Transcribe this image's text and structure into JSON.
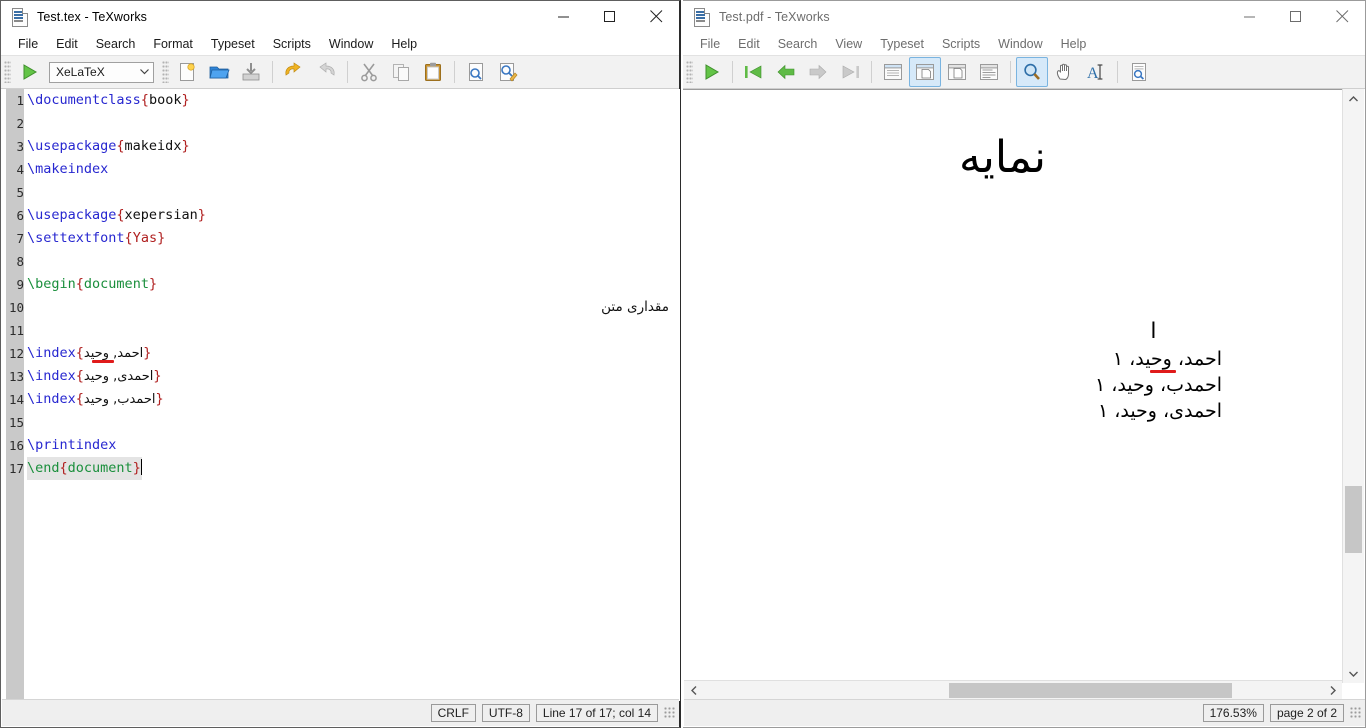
{
  "editor_window": {
    "title": "Test.tex - TeXworks",
    "title_icon": "tex-document-icon",
    "window_controls": [
      "minimize",
      "maximize",
      "close"
    ],
    "menu": [
      "File",
      "Edit",
      "Search",
      "Format",
      "Typeset",
      "Scripts",
      "Window",
      "Help"
    ],
    "toolbar": {
      "typeset_button": "typeset-run-icon",
      "engine_value": "XeLaTeX",
      "engine_options": [
        "XeLaTeX"
      ],
      "buttons": [
        "new-file-icon",
        "open-file-icon",
        "save-file-icon",
        "undo-icon",
        "redo-icon",
        "cut-icon",
        "copy-icon",
        "paste-icon",
        "find-icon",
        "replace-icon"
      ]
    },
    "code_lines": [
      {
        "n": "1",
        "tokens": [
          {
            "t": "\\documentclass",
            "c": "cmd"
          },
          {
            "t": "{",
            "c": "brace"
          },
          {
            "t": "book",
            "c": "txt"
          },
          {
            "t": "}",
            "c": "brace"
          }
        ]
      },
      {
        "n": "2",
        "tokens": []
      },
      {
        "n": "3",
        "tokens": [
          {
            "t": "\\usepackage",
            "c": "cmd"
          },
          {
            "t": "{",
            "c": "brace"
          },
          {
            "t": "makeidx",
            "c": "txt"
          },
          {
            "t": "}",
            "c": "brace"
          }
        ]
      },
      {
        "n": "4",
        "tokens": [
          {
            "t": "\\makeindex",
            "c": "cmd"
          }
        ]
      },
      {
        "n": "5",
        "tokens": []
      },
      {
        "n": "6",
        "tokens": [
          {
            "t": "\\usepackage",
            "c": "cmd"
          },
          {
            "t": "{",
            "c": "brace"
          },
          {
            "t": "xepersian",
            "c": "txt"
          },
          {
            "t": "}",
            "c": "brace"
          }
        ]
      },
      {
        "n": "7",
        "tokens": [
          {
            "t": "\\settextfont",
            "c": "cmd"
          },
          {
            "t": "{",
            "c": "brace"
          },
          {
            "t": "Yas",
            "c": "arg"
          },
          {
            "t": "}",
            "c": "brace"
          }
        ]
      },
      {
        "n": "8",
        "tokens": []
      },
      {
        "n": "9",
        "tokens": [
          {
            "t": "\\begin",
            "c": "env"
          },
          {
            "t": "{",
            "c": "brace"
          },
          {
            "t": "document",
            "c": "env"
          },
          {
            "t": "}",
            "c": "brace"
          }
        ]
      },
      {
        "n": "10",
        "tokens": [],
        "right_text": "مقداری متن"
      },
      {
        "n": "11",
        "tokens": []
      },
      {
        "n": "12",
        "tokens": [
          {
            "t": "\\index",
            "c": "cmd"
          },
          {
            "t": "{",
            "c": "brace"
          },
          {
            "t": "احمد, وحید",
            "c": "fa"
          },
          {
            "t": "}",
            "c": "brace"
          }
        ],
        "red_underline": true
      },
      {
        "n": "13",
        "tokens": [
          {
            "t": "\\index",
            "c": "cmd"
          },
          {
            "t": "{",
            "c": "brace"
          },
          {
            "t": "احمدی, وحید",
            "c": "fa"
          },
          {
            "t": "}",
            "c": "brace"
          }
        ]
      },
      {
        "n": "14",
        "tokens": [
          {
            "t": "\\index",
            "c": "cmd"
          },
          {
            "t": "{",
            "c": "brace"
          },
          {
            "t": "احمدب, وحید",
            "c": "fa"
          },
          {
            "t": "}",
            "c": "brace"
          }
        ]
      },
      {
        "n": "15",
        "tokens": []
      },
      {
        "n": "16",
        "tokens": [
          {
            "t": "\\printindex",
            "c": "cmd"
          }
        ]
      },
      {
        "n": "17",
        "tokens": [
          {
            "t": "\\end",
            "c": "env"
          },
          {
            "t": "{",
            "c": "brace"
          },
          {
            "t": "document",
            "c": "env"
          },
          {
            "t": "}",
            "c": "brace"
          }
        ],
        "current": true,
        "caret": true
      }
    ],
    "status": {
      "line_ending": "CRLF",
      "encoding": "UTF-8",
      "position": "Line 17 of 17; col 14"
    }
  },
  "pdf_window": {
    "title": "Test.pdf - TeXworks",
    "title_icon": "pdf-document-icon",
    "window_controls": [
      "minimize",
      "maximize",
      "close"
    ],
    "menu": [
      "File",
      "Edit",
      "Search",
      "View",
      "Typeset",
      "Scripts",
      "Window",
      "Help"
    ],
    "toolbar": {
      "buttons": [
        "typeset-run-icon",
        "first-page-icon",
        "previous-page-icon",
        "next-page-icon",
        "last-page-icon",
        "fit-width-icon",
        "fit-window-icon",
        "actual-size-icon",
        "fit-content-icon",
        "magnify-tool-icon",
        "pan-tool-icon",
        "text-select-tool-icon",
        "source-preview-icon"
      ],
      "active": [
        "fit-window-icon",
        "magnify-tool-icon"
      ]
    },
    "page": {
      "heading": "نمایه",
      "index_letter": "ا",
      "entries": [
        {
          "text": "احمد، وحید، ۱",
          "red_underline": true
        },
        {
          "text": "احمدب، وحید، ۱",
          "red_underline": false
        },
        {
          "text": "احمدی، وحید، ۱",
          "red_underline": false
        }
      ]
    },
    "status": {
      "zoom": "176.53%",
      "page": "page 2 of 2"
    },
    "scrollbars": {
      "vertical_up": "scroll-up-arrow",
      "vertical_down": "scroll-down-arrow",
      "horizontal_left": "scroll-left-arrow",
      "horizontal_right": "scroll-right-arrow"
    }
  },
  "colors": {
    "command": "#2727d0",
    "environment": "#1a8f3c",
    "brace": "#b02020",
    "red_mark": "#e01b1b",
    "toolbar_bg": "#f2f2f2",
    "gutter_bg": "#c9c9c9",
    "active_toolbutton": "#d6e9f9"
  }
}
